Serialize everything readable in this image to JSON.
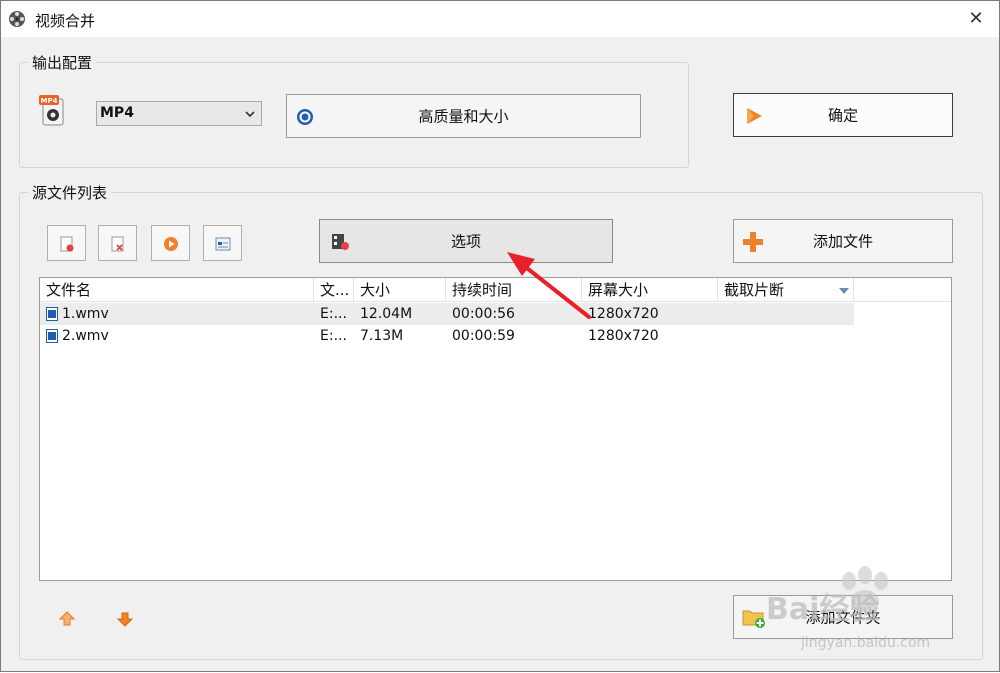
{
  "window": {
    "title": "视频合并",
    "close_glyph": "✕"
  },
  "output_group": {
    "legend": "输出配置",
    "format_value": "MP4",
    "format_icon_badge": "MP4",
    "quality_button": "高质量和大小",
    "ok_button": "确定"
  },
  "source_group": {
    "legend": "源文件列表",
    "options_button": "选项",
    "add_file_button": "添加文件",
    "add_folder_button": "添加文件夹"
  },
  "file_list": {
    "columns": [
      "文件名",
      "文...",
      "大小",
      "持续时间",
      "屏幕大小",
      "截取片断"
    ],
    "rows": [
      {
        "name": "1.wmv",
        "folder": "E:...",
        "size": "12.04M",
        "duration": "00:00:56",
        "screen": "1280x720",
        "clip": ""
      },
      {
        "name": "2.wmv",
        "folder": "E:...",
        "size": "7.13M",
        "duration": "00:00:59",
        "screen": "1280x720",
        "clip": ""
      }
    ],
    "selected_row": 0
  },
  "watermark": {
    "brand": "Bai经验",
    "url": "jingyan.baidu.com"
  },
  "colors": {
    "accent_orange": "#f0802a",
    "annotation_red": "#e8202a",
    "blue_icon": "#1f5fae"
  }
}
